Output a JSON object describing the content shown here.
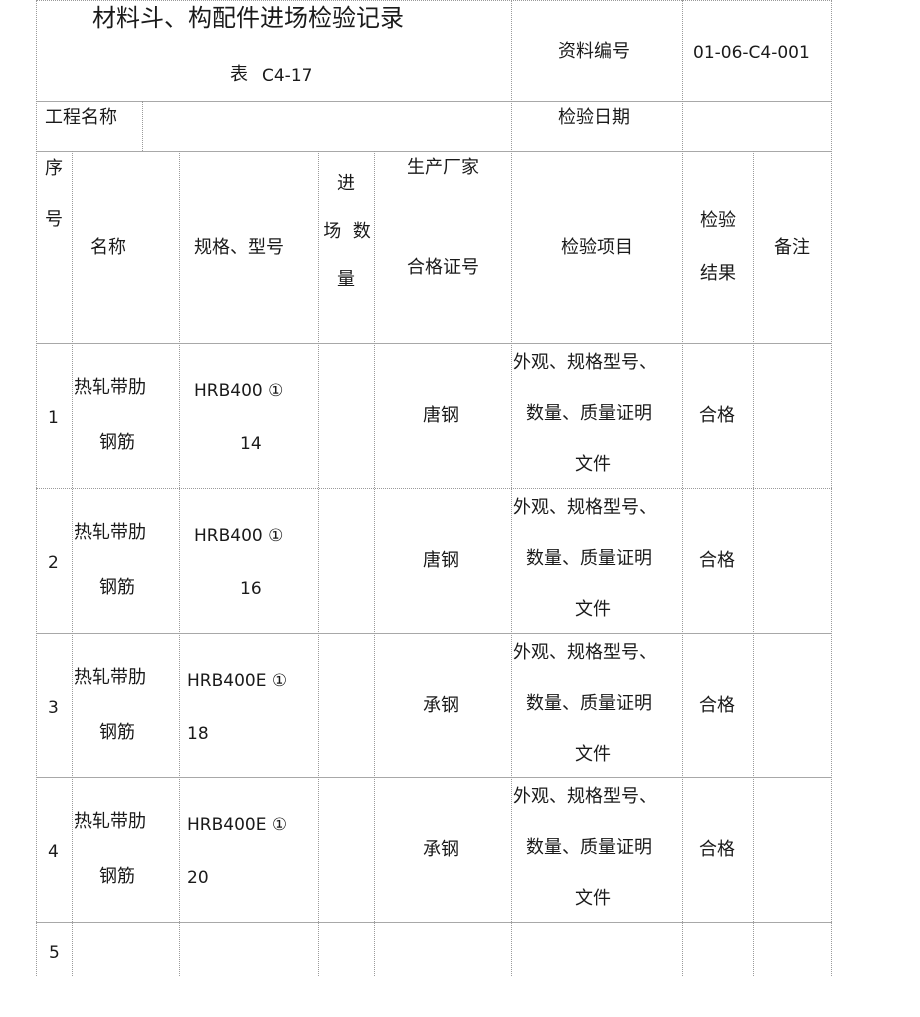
{
  "header": {
    "title": "材料斗、构配件进场检验记录",
    "form_prefix": "表",
    "form_code": "C4-17",
    "doc_no_label": "资料编号",
    "doc_no_value": "01-06-C4-001",
    "project_label": "工程名称",
    "project_value": "",
    "date_label": "检验日期",
    "date_value": ""
  },
  "columns": {
    "seq_1": "序",
    "seq_2": "号",
    "name": "名称",
    "spec": "规格、型号",
    "qty_1": "进",
    "qty_2": "场  数",
    "qty_3": "量",
    "maker_1": "生产厂家",
    "maker_2": "合格证号",
    "items": "检验项目",
    "result_1": "检验",
    "result_2": "结果",
    "remark": "备注"
  },
  "rows": [
    {
      "seq": "1",
      "name_1": "热轧带肋",
      "name_2": "钢筋",
      "spec_1": "HRB400 ①",
      "spec_2": "14",
      "qty": "",
      "maker": "唐钢",
      "items_1": "外观、规格型号、",
      "items_2": "数量、质量证明",
      "items_3": "文件",
      "result": "合格",
      "remark": ""
    },
    {
      "seq": "2",
      "name_1": "热轧带肋",
      "name_2": "钢筋",
      "spec_1": "HRB400 ①",
      "spec_2": "16",
      "qty": "",
      "maker": "唐钢",
      "items_1": "外观、规格型号、",
      "items_2": "数量、质量证明",
      "items_3": "文件",
      "result": "合格",
      "remark": ""
    },
    {
      "seq": "3",
      "name_1": "热轧带肋",
      "name_2": "钢筋",
      "spec_1": "HRB400E ①",
      "spec_2": "18",
      "qty": "",
      "maker": "承钢",
      "items_1": "外观、规格型号、",
      "items_2": "数量、质量证明",
      "items_3": "文件",
      "result": "合格",
      "remark": ""
    },
    {
      "seq": "4",
      "name_1": "热轧带肋",
      "name_2": "钢筋",
      "spec_1": "HRB400E ①",
      "spec_2": "20",
      "qty": "",
      "maker": "承钢",
      "items_1": "外观、规格型号、",
      "items_2": "数量、质量证明",
      "items_3": "文件",
      "result": "合格",
      "remark": ""
    },
    {
      "seq": "5",
      "name_1": "",
      "name_2": "",
      "spec_1": "",
      "spec_2": "",
      "qty": "",
      "maker": "",
      "items_1": "",
      "items_2": "",
      "items_3": "",
      "result": "",
      "remark": ""
    }
  ]
}
